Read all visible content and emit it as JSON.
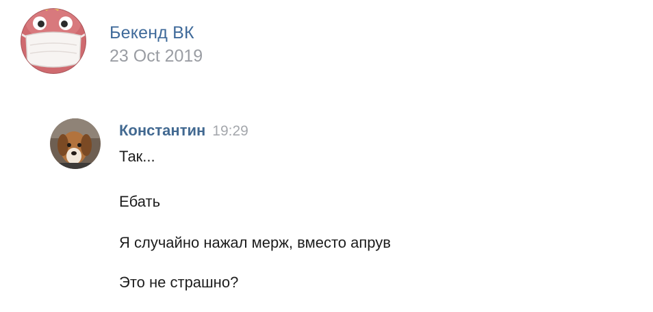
{
  "post": {
    "group_name": "Бекенд ВК",
    "date": "23 Oct 2019",
    "group_avatar_icon": "mascot-with-face-mask-icon"
  },
  "message": {
    "author": "Константин",
    "time": "19:29",
    "avatar_icon": "dog-photo-avatar",
    "lines": [
      "Так...",
      "Ебать",
      "Я случайно нажал мерж, вместо апрув",
      "Это не страшно?"
    ]
  },
  "colors": {
    "link_blue": "#3f6a9a",
    "muted_gray": "#9a9da3",
    "text": "#1c1c1c",
    "avatar_red": "#c95a5f"
  }
}
